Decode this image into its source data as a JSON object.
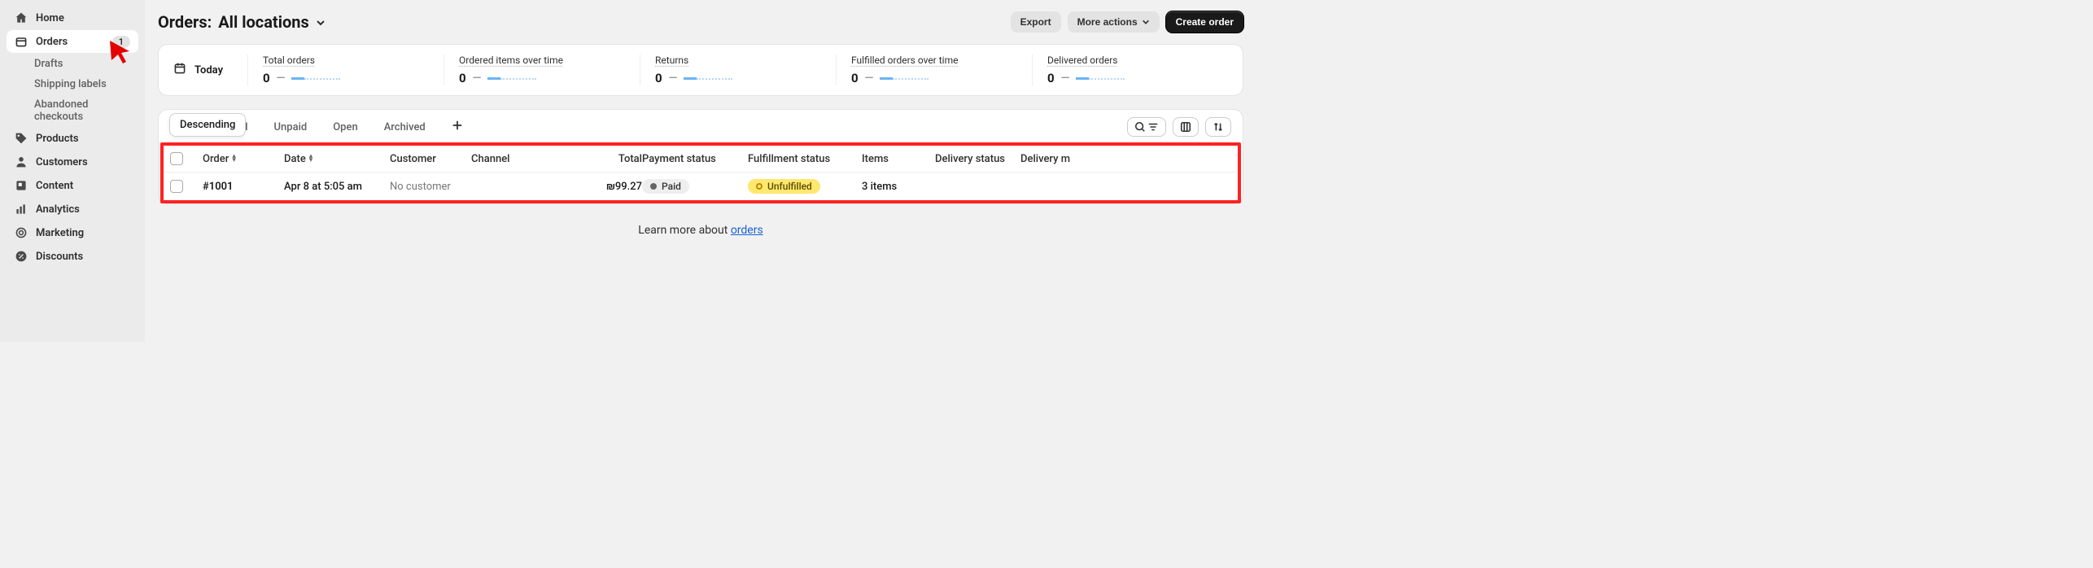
{
  "sidebar": {
    "home": "Home",
    "orders": "Orders",
    "orders_badge": "1",
    "drafts": "Drafts",
    "shipping_labels": "Shipping labels",
    "abandoned": "Abandoned checkouts",
    "products": "Products",
    "customers": "Customers",
    "content": "Content",
    "analytics": "Analytics",
    "marketing": "Marketing",
    "discounts": "Discounts"
  },
  "header": {
    "title_prefix": "Orders:",
    "title_location": "All locations",
    "export": "Export",
    "more_actions": "More actions",
    "create_order": "Create order"
  },
  "stats": {
    "date_label": "Today",
    "items": [
      {
        "label": "Total orders",
        "value": "0",
        "dash": "—"
      },
      {
        "label": "Ordered items over time",
        "value": "0",
        "dash": "—"
      },
      {
        "label": "Returns",
        "value": "0",
        "dash": "—"
      },
      {
        "label": "Fulfilled orders over time",
        "value": "0",
        "dash": "—"
      },
      {
        "label": "Delivered orders",
        "value": "0",
        "dash": "—"
      }
    ]
  },
  "tabs": {
    "sort_tooltip": "Descending",
    "hidden_partial": "ed",
    "unpaid": "Unpaid",
    "open": "Open",
    "archived": "Archived"
  },
  "table": {
    "headers": {
      "order": "Order",
      "date": "Date",
      "customer": "Customer",
      "channel": "Channel",
      "total": "Total",
      "payment_status": "Payment status",
      "fulfillment_status": "Fulfillment status",
      "items": "Items",
      "delivery_status": "Delivery status",
      "delivery_method": "Delivery m"
    },
    "row": {
      "order": "#1001",
      "date": "Apr 8 at 5:05 am",
      "customer": "No customer",
      "total": "₪99.27",
      "payment_status": "Paid",
      "fulfillment_status": "Unfulfilled",
      "items": "3 items"
    }
  },
  "footer": {
    "text": "Learn more about ",
    "link": "orders"
  }
}
